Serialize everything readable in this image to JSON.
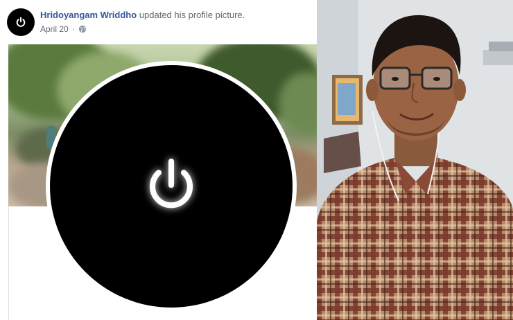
{
  "post": {
    "author_name": "Hridoyangam Wriddho",
    "action_text": "updated his profile picture.",
    "date": "April 20",
    "privacy_icon": "globe-icon",
    "power_icon": "power-icon"
  },
  "colors": {
    "author_link": "#365899",
    "meta_text": "#616770",
    "profile_bg": "#000000",
    "shirt_check": "#7a3a2a"
  }
}
